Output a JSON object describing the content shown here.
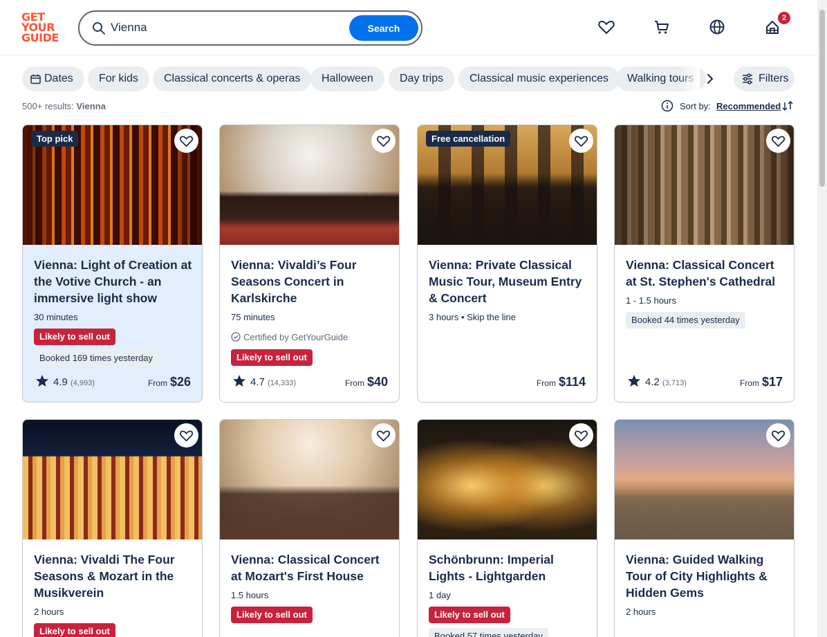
{
  "logo": {
    "line1": "GET",
    "line2": "YOUR",
    "line3": "GUIDE"
  },
  "search": {
    "value": "Vienna",
    "button": "Search"
  },
  "header": {
    "cart_badge": "2"
  },
  "chips": [
    "Dates",
    "For kids",
    "Classical concerts & operas",
    "Halloween",
    "Day trips",
    "Classical music experiences",
    "Walking tours"
  ],
  "filters_label": "Filters",
  "results": {
    "count": "500+ results:",
    "query": "Vienna"
  },
  "sort": {
    "label": "Sort by:",
    "value": "Recommended"
  },
  "cards": [
    {
      "tag": "Top pick",
      "title": "Vienna: Light of Creation at the Votive Church - an immersive light show",
      "duration": "30 minutes",
      "sell": "Likely to sell out",
      "booked": "Booked 169 times yesterday",
      "rating": "4.9",
      "reviews": "(4,993)",
      "from": "From",
      "price": "$26"
    },
    {
      "title": "Vienna: Vivaldi’s Four Seasons Concert in Karlskirche",
      "duration": "75 minutes",
      "cert": "Certified by GetYourGuide",
      "sell": "Likely to sell out",
      "rating": "4.7",
      "reviews": "(14,333)",
      "from": "From",
      "price": "$40"
    },
    {
      "tag": "Free cancellation",
      "title": "Vienna: Private Classical Music Tour, Museum Entry & Concert",
      "duration": "3 hours • Skip the line",
      "from": "From",
      "price": "$114"
    },
    {
      "title": "Vienna: Classical Concert at St. Stephen's Cathedral",
      "duration": "1 - 1.5 hours",
      "booked": "Booked 44 times yesterday",
      "rating": "4.2",
      "reviews": "(3,713)",
      "from": "From",
      "price": "$17"
    },
    {
      "title": "Vienna: Vivaldi The Four Seasons & Mozart in the Musikverein",
      "duration": "2 hours",
      "sell": "Likely to sell out"
    },
    {
      "title": "Vienna: Classical Concert at Mozart's First House",
      "duration": "1.5 hours",
      "sell": "Likely to sell out"
    },
    {
      "title": "Schönbrunn: Imperial Lights - Lightgarden",
      "duration": "1 day",
      "sell": "Likely to sell out",
      "booked": "Booked 57 times yesterday"
    },
    {
      "title": "Vienna: Guided Walking Tour of City Highlights & Hidden Gems",
      "duration": "2 hours"
    }
  ],
  "colors": {
    "brand": "#ff5533",
    "accent": "#0071eb",
    "sell_out": "#c8223c",
    "text": "#1a2b49"
  }
}
